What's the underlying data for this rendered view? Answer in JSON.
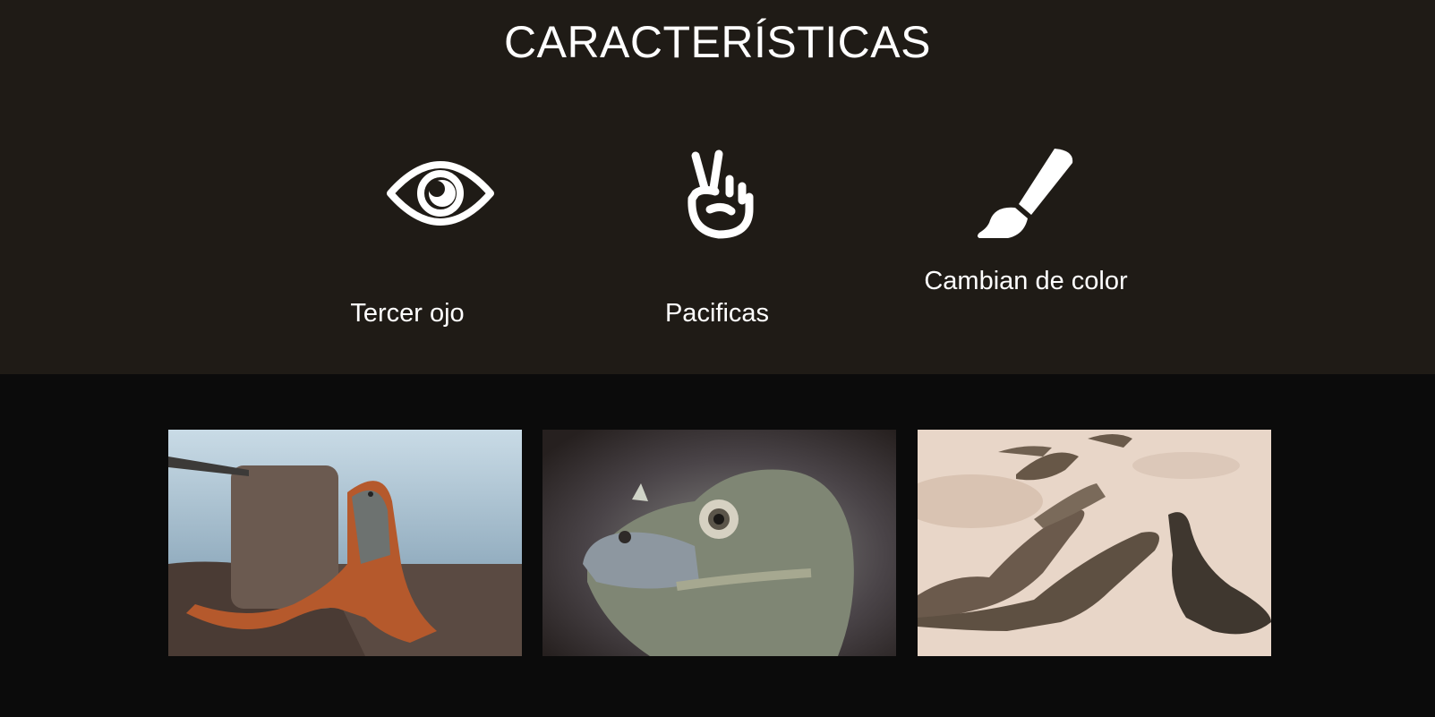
{
  "features_section": {
    "title": "CARACTERÍSTICAS",
    "items": [
      {
        "label": "Tercer ojo",
        "icon": "eye-icon"
      },
      {
        "label": "Pacificas",
        "icon": "peace-hand-icon"
      },
      {
        "label": "Cambian de color",
        "icon": "paint-brush-icon"
      }
    ]
  },
  "gallery": {
    "images": [
      {
        "name": "orange-iguana-photo"
      },
      {
        "name": "iguana-head-closeup-photo"
      },
      {
        "name": "iguanas-on-sand-photo"
      }
    ]
  },
  "colors": {
    "features_bg": "#1f1b16",
    "gallery_bg": "#0b0b0b",
    "text": "#ffffff"
  }
}
